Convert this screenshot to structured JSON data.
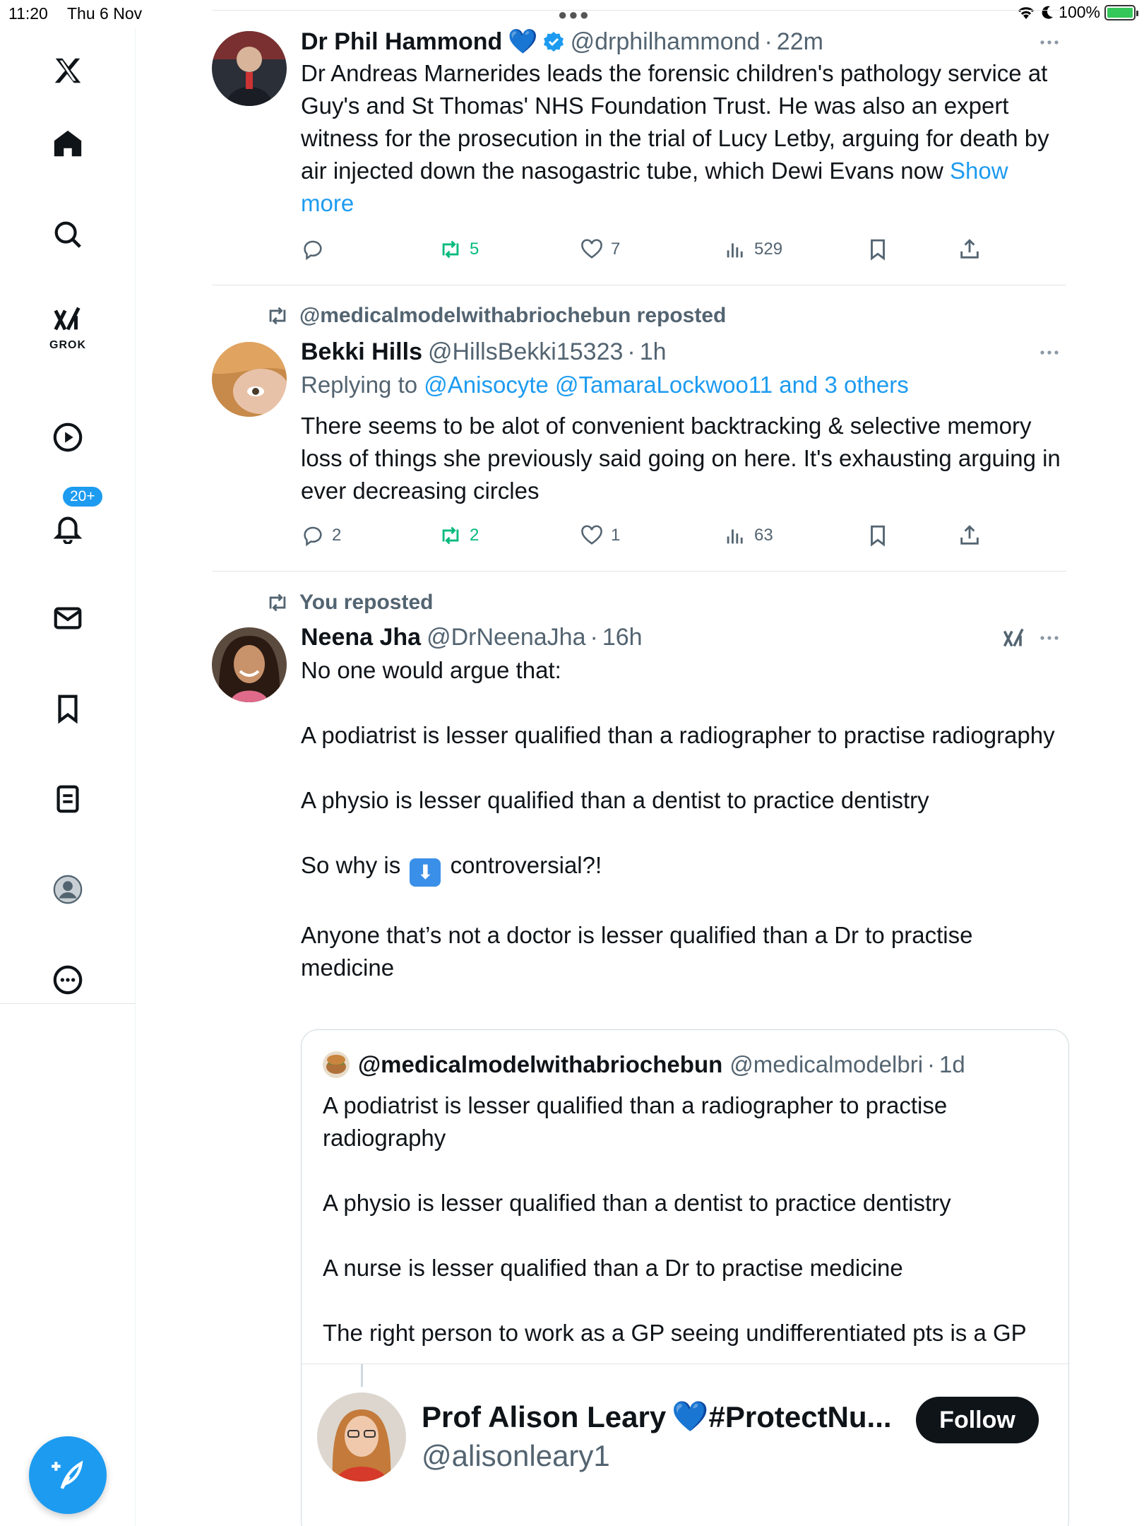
{
  "status_bar": {
    "time": "11:20",
    "date": "Thu 6 Nov",
    "battery": "100%"
  },
  "sidebar": {
    "grok_label": "GROK",
    "notifications_badge": "20+",
    "items": [
      "x-logo",
      "home",
      "search",
      "grok",
      "video",
      "notifications",
      "messages",
      "bookmarks",
      "lists",
      "profile",
      "more"
    ]
  },
  "tweets": [
    {
      "name": "Dr Phil Hammond",
      "emoji": "💙",
      "handle": "@drphilhammond",
      "time": "22m",
      "text": "Dr Andreas Marnerides leads the forensic children's pathology service at Guy's and St Thomas' NHS Foundation Trust.  He was also an expert witness for the prosecution in the trial of Lucy Letby, arguing for death by air injected down the nasogastric tube, which Dewi Evans now",
      "show_more": "Show more",
      "replies": "",
      "reposts": "5",
      "likes": "7",
      "views": "529"
    },
    {
      "repost_label": "@medicalmodelwithabriochebun reposted",
      "name": "Bekki Hills",
      "handle": "@HillsBekki15323",
      "time": "1h",
      "replying_prefix": "Replying to",
      "replying_to": "@Anisocyte @TamaraLockwoo11 and 3 others",
      "text": "There seems to be alot of convenient backtracking & selective memory loss of things she previously said going on here. It's exhausting arguing in ever decreasing circles",
      "replies": "2",
      "reposts": "2",
      "likes": "1",
      "views": "63"
    },
    {
      "repost_label": "You reposted",
      "name": "Neena Jha",
      "handle": "@DrNeenaJha",
      "time": "16h",
      "paragraphs": [
        "No one would argue that:",
        "A podiatrist is lesser qualified than a radiographer to practise radiography",
        "A physio is lesser qualified than a dentist to practice dentistry"
      ],
      "p4_before": "So why is",
      "p4_emoji": "⬇",
      "p4_after": "controversial?!",
      "p5": "Anyone that’s not a doctor is lesser qualified than a Dr to practise medicine",
      "quote": {
        "name": "@medicalmodelwithabriochebun",
        "handle": "@medicalmodelbri",
        "time": "1d",
        "paragraphs": [
          "A podiatrist is lesser qualified than a radiographer to practise radiography",
          "A physio is lesser qualified than a dentist to practice dentistry",
          "A nurse is lesser qualified than a Dr to practise medicine",
          "The right person to work as a GP seeing undifferentiated pts is a GP"
        ],
        "inner": {
          "name": "Prof Alison Leary",
          "emoji": "💙",
          "name_suffix": "#ProtectNu...",
          "handle": "@alisonleary1",
          "follow_label": "Follow"
        }
      }
    }
  ],
  "colors": {
    "accent": "#1d9bf0",
    "repost_green": "#00ba7c",
    "muted": "#536471"
  }
}
